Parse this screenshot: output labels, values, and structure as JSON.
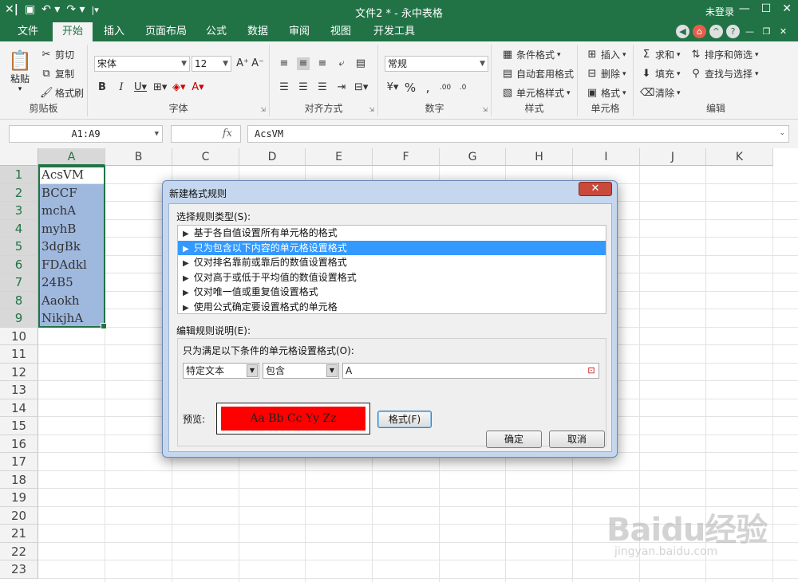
{
  "titlebar": {
    "doc_title": "文件2 * - 永中表格",
    "login": "未登录",
    "icons": [
      "app-logo-icon",
      "save-icon",
      "undo-icon",
      "redo-icon",
      "customize-icon"
    ]
  },
  "tabs": [
    {
      "label": "文件",
      "active": false
    },
    {
      "label": "开始",
      "active": true
    },
    {
      "label": "插入",
      "active": false
    },
    {
      "label": "页面布局",
      "active": false
    },
    {
      "label": "公式",
      "active": false
    },
    {
      "label": "数据",
      "active": false
    },
    {
      "label": "审阅",
      "active": false
    },
    {
      "label": "视图",
      "active": false
    },
    {
      "label": "开发工具",
      "active": false
    }
  ],
  "ribbon": {
    "clipboard": {
      "paste": "粘贴",
      "cut": "剪切",
      "copy": "复制",
      "format_painter": "格式刷",
      "label": "剪贴板"
    },
    "font": {
      "name": "宋体",
      "size": "12",
      "label": "字体"
    },
    "align": {
      "label": "对齐方式"
    },
    "number": {
      "format": "常规",
      "label": "数字"
    },
    "style": {
      "cond_format": "条件格式",
      "table_format": "自动套用格式",
      "cell_style": "单元格样式",
      "label": "样式"
    },
    "cells": {
      "insert": "插入",
      "delete": "删除",
      "format": "格式",
      "label": "单元格"
    },
    "edit": {
      "sum": "求和",
      "sort_filter": "排序和筛选",
      "fill": "填充",
      "find_select": "查找与选择",
      "clear": "清除",
      "label": "编辑"
    }
  },
  "formula_bar": {
    "name_box": "A1:A9",
    "fx": "fx",
    "value": "AcsVM"
  },
  "grid": {
    "columns": [
      "A",
      "B",
      "C",
      "D",
      "E",
      "F",
      "G",
      "H",
      "I",
      "J",
      "K"
    ],
    "rows": [
      "1",
      "2",
      "3",
      "4",
      "5",
      "6",
      "7",
      "8",
      "9",
      "10",
      "11",
      "12",
      "13",
      "14",
      "15",
      "16",
      "17",
      "18",
      "19",
      "20",
      "21",
      "22",
      "23"
    ],
    "col_a_values": [
      "AcsVM",
      "BCCF",
      "mchA",
      "myhB",
      "3dgBk",
      "FDAdkl",
      "24B5",
      "Aaokh",
      "NikjhA"
    ]
  },
  "dialog": {
    "title": "新建格式规则",
    "close": "✕",
    "select_type_label": "选择规则类型(S):",
    "rules": [
      {
        "label": "基于各自值设置所有单元格的格式",
        "selected": false
      },
      {
        "label": "只为包含以下内容的单元格设置格式",
        "selected": true
      },
      {
        "label": "仅对排名靠前或靠后的数值设置格式",
        "selected": false
      },
      {
        "label": "仅对高于或低于平均值的数值设置格式",
        "selected": false
      },
      {
        "label": "仅对唯一值或重复值设置格式",
        "selected": false
      },
      {
        "label": "使用公式确定要设置格式的单元格",
        "selected": false
      }
    ],
    "edit_desc_label": "编辑规则说明(E):",
    "condition_label": "只为满足以下条件的单元格设置格式(O):",
    "combo1": "特定文本",
    "combo2": "包含",
    "text_value": "A",
    "preview_label": "预览:",
    "preview_text": "Aa Bb Cc Yy Zz",
    "preview_color": "#ff0000",
    "format_button": "格式(F)",
    "ok_button": "确定",
    "cancel_button": "取消"
  },
  "watermark": {
    "big": "Baidu经验",
    "small": "jingyan.baidu.com"
  },
  "colors": {
    "accent": "#217346",
    "selection": "#9fb8de",
    "list_selected": "#3399ff"
  }
}
